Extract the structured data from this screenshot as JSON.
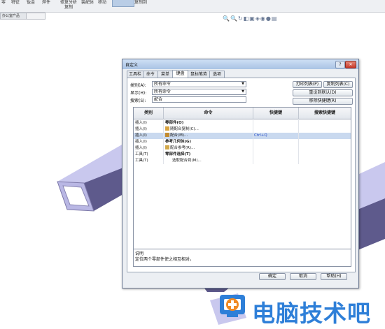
{
  "ribbon": {
    "items": [
      "零",
      "特征",
      "钣金",
      "焊件",
      "修复分析复制",
      "装配体",
      "移动",
      "复制到",
      "图纸",
      "标注"
    ],
    "doc_tab": "办公室产品"
  },
  "dialog": {
    "title": "自定义",
    "help": "?",
    "close": "✕",
    "tabs": [
      "工具栏",
      "命令",
      "菜单",
      "键盘",
      "鼠标笔势",
      "选项"
    ],
    "category_label": "类别(A):",
    "category_value": "所有命令",
    "show_label": "显示(H):",
    "show_value": "所有命令",
    "search_label": "搜索(S):",
    "search_value": "配合",
    "buttons": {
      "print": "打印列表(P)",
      "copy": "复制列表(C)",
      "reset": "重设到默认(D)",
      "remove": "移除快捷键(R)"
    },
    "columns": [
      "类别",
      "命令",
      "快捷键",
      "搜索快捷键"
    ],
    "rows": [
      {
        "category": "插入(I)",
        "command": "零部件(O)",
        "shortcut": "",
        "search": "",
        "bold": true,
        "icon": ""
      },
      {
        "category": "插入(I)",
        "command": "随配合复制(C)...",
        "shortcut": "",
        "search": "",
        "bold": false,
        "icon": "copy-mate-icon"
      },
      {
        "category": "插入(I)",
        "command": "配合(M)...",
        "shortcut": "Ctrl+Q",
        "search": "",
        "bold": false,
        "icon": "mate-icon",
        "selected": true
      },
      {
        "category": "插入(I)",
        "command": "参考几何体(G)",
        "shortcut": "",
        "search": "",
        "bold": true,
        "icon": ""
      },
      {
        "category": "插入(I)",
        "command": "配合参考(R)...",
        "shortcut": "",
        "search": "",
        "bold": false,
        "icon": "mate-reference-icon"
      },
      {
        "category": "工具(T)",
        "command": "零部件选择(T)",
        "shortcut": "",
        "search": "",
        "bold": true,
        "icon": ""
      },
      {
        "category": "工具(T)",
        "command": "选取配合到(M)...",
        "shortcut": "",
        "search": "",
        "bold": false,
        "icon": ""
      }
    ],
    "description_label": "说明",
    "description_text": "定位两个零部件使之相互相对。",
    "ok": "确定",
    "cancel": "取消",
    "help_button": "帮助(H)"
  },
  "watermark": {
    "text": "电脑技术吧"
  },
  "colors": {
    "selection": "#c9d9ef",
    "shortcut": "#2b50c8",
    "watermark": "#2e7fd8",
    "tube_top": "#c9c8ee",
    "tube_side": "#5e5a8c"
  }
}
